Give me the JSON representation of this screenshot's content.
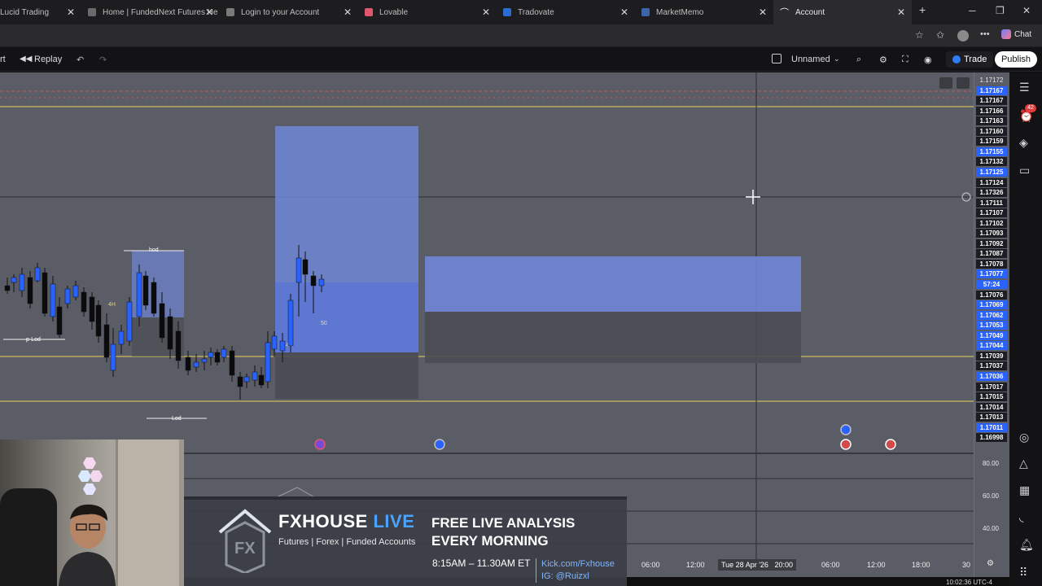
{
  "browser": {
    "tabs": [
      {
        "title": "Lucid Trading",
        "fav": "#222a36"
      },
      {
        "title": "Home | FundedNext Futures He",
        "fav": "#6b6b6b"
      },
      {
        "title": "Login to your Account",
        "fav": "#7a7a7a"
      },
      {
        "title": "Lovable",
        "fav": "#e0566f"
      },
      {
        "title": "Tradovate",
        "fav": "#2b6ed3"
      },
      {
        "title": "MarketMemo",
        "fav": "#3a66a8"
      },
      {
        "title": "Account",
        "fav": "#ffffff"
      }
    ],
    "active_tab_index": 6,
    "chat_label": "Chat"
  },
  "toolbar": {
    "partial_label": "rt",
    "replay_label": "Replay",
    "layout_name": "Unnamed",
    "trade_label": "Trade",
    "publish_label": "Publish"
  },
  "price_scale": [
    {
      "v": "1.17172",
      "s": "plain"
    },
    {
      "v": "1.17167",
      "s": "blue"
    },
    {
      "v": "1.17167",
      "s": "dark"
    },
    {
      "v": "1.17166",
      "s": "dark"
    },
    {
      "v": "1.17163",
      "s": "dark"
    },
    {
      "v": "1.17160",
      "s": "dark"
    },
    {
      "v": "1.17159",
      "s": "dark"
    },
    {
      "v": "1.17155",
      "s": "blue"
    },
    {
      "v": "1.17132",
      "s": "dark"
    },
    {
      "v": "1.17125",
      "s": "blue"
    },
    {
      "v": "1.17124",
      "s": "dark"
    },
    {
      "v": "1.17326",
      "s": "dark"
    },
    {
      "v": "1.17111",
      "s": "dark"
    },
    {
      "v": "1.17107",
      "s": "dark"
    },
    {
      "v": "1.17102",
      "s": "dark"
    },
    {
      "v": "1.17093",
      "s": "dark"
    },
    {
      "v": "1.17092",
      "s": "dark"
    },
    {
      "v": "1.17087",
      "s": "dark"
    },
    {
      "v": "1.17078",
      "s": "dark"
    },
    {
      "v": "1.17077",
      "s": "blue"
    },
    {
      "v": "57:24",
      "s": "blue"
    },
    {
      "v": "1.17076",
      "s": "dark"
    },
    {
      "v": "1.17069",
      "s": "blue"
    },
    {
      "v": "1.17062",
      "s": "blue"
    },
    {
      "v": "1.17053",
      "s": "blue"
    },
    {
      "v": "1.17049",
      "s": "blue"
    },
    {
      "v": "1.17044",
      "s": "blue"
    },
    {
      "v": "1.17039",
      "s": "dark"
    },
    {
      "v": "1.17037",
      "s": "dark"
    },
    {
      "v": "1.17036",
      "s": "blue"
    },
    {
      "v": "1.17017",
      "s": "dark"
    },
    {
      "v": "1.17015",
      "s": "dark"
    },
    {
      "v": "1.17014",
      "s": "dark"
    },
    {
      "v": "1.17013",
      "s": "dark"
    },
    {
      "v": "1.17011",
      "s": "blue"
    },
    {
      "v": "1.16998",
      "s": "dark"
    }
  ],
  "indicator_scale": [
    "80.00",
    "60.00",
    "40.00"
  ],
  "chart_labels": {
    "hod": "hod",
    "plod": "p-Lod",
    "lod": "Lod",
    "h4": "4H",
    "fifty": "50",
    "h4b": "4H"
  },
  "time_axis": {
    "labels": [
      "06:00",
      "12:00",
      "20:00",
      "06:00",
      "12:00",
      "18:00",
      "30"
    ],
    "crosshair": "Tue 28 Apr '26",
    "clock": "10:02:36 UTC-4"
  },
  "alerts_badge": "42",
  "banner": {
    "brand": "FXHOUSE",
    "live": "LIVE",
    "subtitle": "Futures | Forex | Funded Accounts",
    "headline_1": "FREE LIVE ANALYSIS",
    "headline_2": "EVERY MORNING",
    "time": "8:15AM – 11.30AM ET",
    "kick": "Kick.com/Fxhouse",
    "ig": "IG: @Ruizxl"
  }
}
